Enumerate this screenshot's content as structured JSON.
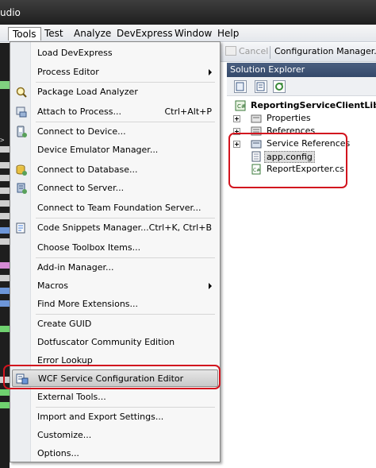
{
  "window": {
    "title_fragment": "udio"
  },
  "menubar": {
    "items": [
      {
        "label": "Tools",
        "active": true
      },
      {
        "label": "Test"
      },
      {
        "label": "Analyze"
      },
      {
        "label": "DevExpress"
      },
      {
        "label": "Window"
      },
      {
        "label": "Help"
      }
    ]
  },
  "toolbar": {
    "cancel_label": "Cancel",
    "config_label": "Configuration Manager..."
  },
  "tools_menu": {
    "items": [
      {
        "label": "Load DevExpress",
        "icon": "none"
      },
      {
        "label": "Process Editor",
        "icon": "none",
        "submenu": true
      },
      {
        "label": "Package Load Analyzer",
        "icon": "magnifier-icon"
      },
      {
        "label": "Attach to Process...",
        "icon": "attach-icon",
        "shortcut": "Ctrl+Alt+P"
      },
      {
        "label": "Connect to Device...",
        "icon": "device-icon"
      },
      {
        "label": "Device Emulator Manager...",
        "icon": "none"
      },
      {
        "label": "Connect to Database...",
        "icon": "database-icon"
      },
      {
        "label": "Connect to Server...",
        "icon": "server-icon"
      },
      {
        "label": "Connect to Team Foundation Server...",
        "icon": "none"
      },
      {
        "label": "Code Snippets Manager...",
        "icon": "snippets-icon",
        "shortcut": "Ctrl+K, Ctrl+B"
      },
      {
        "label": "Choose Toolbox Items...",
        "icon": "none"
      },
      {
        "label": "Add-in Manager...",
        "icon": "none"
      },
      {
        "label": "Macros",
        "icon": "none",
        "submenu": true
      },
      {
        "label": "Find More Extensions...",
        "icon": "none"
      },
      {
        "label": "Create GUID",
        "icon": "none"
      },
      {
        "label": "Dotfuscator Community Edition",
        "icon": "none"
      },
      {
        "label": "Error Lookup",
        "icon": "none"
      },
      {
        "label": "WCF Service Configuration Editor",
        "icon": "wcf-editor-icon",
        "highlighted": true
      },
      {
        "label": "External Tools...",
        "icon": "none"
      },
      {
        "label": "Import and Export Settings...",
        "icon": "none"
      },
      {
        "label": "Customize...",
        "icon": "none"
      },
      {
        "label": "Options...",
        "icon": "none"
      }
    ]
  },
  "solution_explorer": {
    "title": "Solution Explorer",
    "project": "ReportingServiceClientLib",
    "nodes": [
      {
        "label": "Properties",
        "icon": "properties-icon"
      },
      {
        "label": "References",
        "icon": "references-icon"
      },
      {
        "label": "Service References",
        "icon": "service-references-icon"
      },
      {
        "label": "app.config",
        "icon": "config-file-icon",
        "selected": true
      },
      {
        "label": "ReportExporter.cs",
        "icon": "csharp-file-icon"
      }
    ]
  },
  "colors": {
    "annotation": "#d2141e",
    "menu_bg": "#f7f7f7",
    "se_header": "#3f5374",
    "code_bg": "#1e1e1e"
  }
}
